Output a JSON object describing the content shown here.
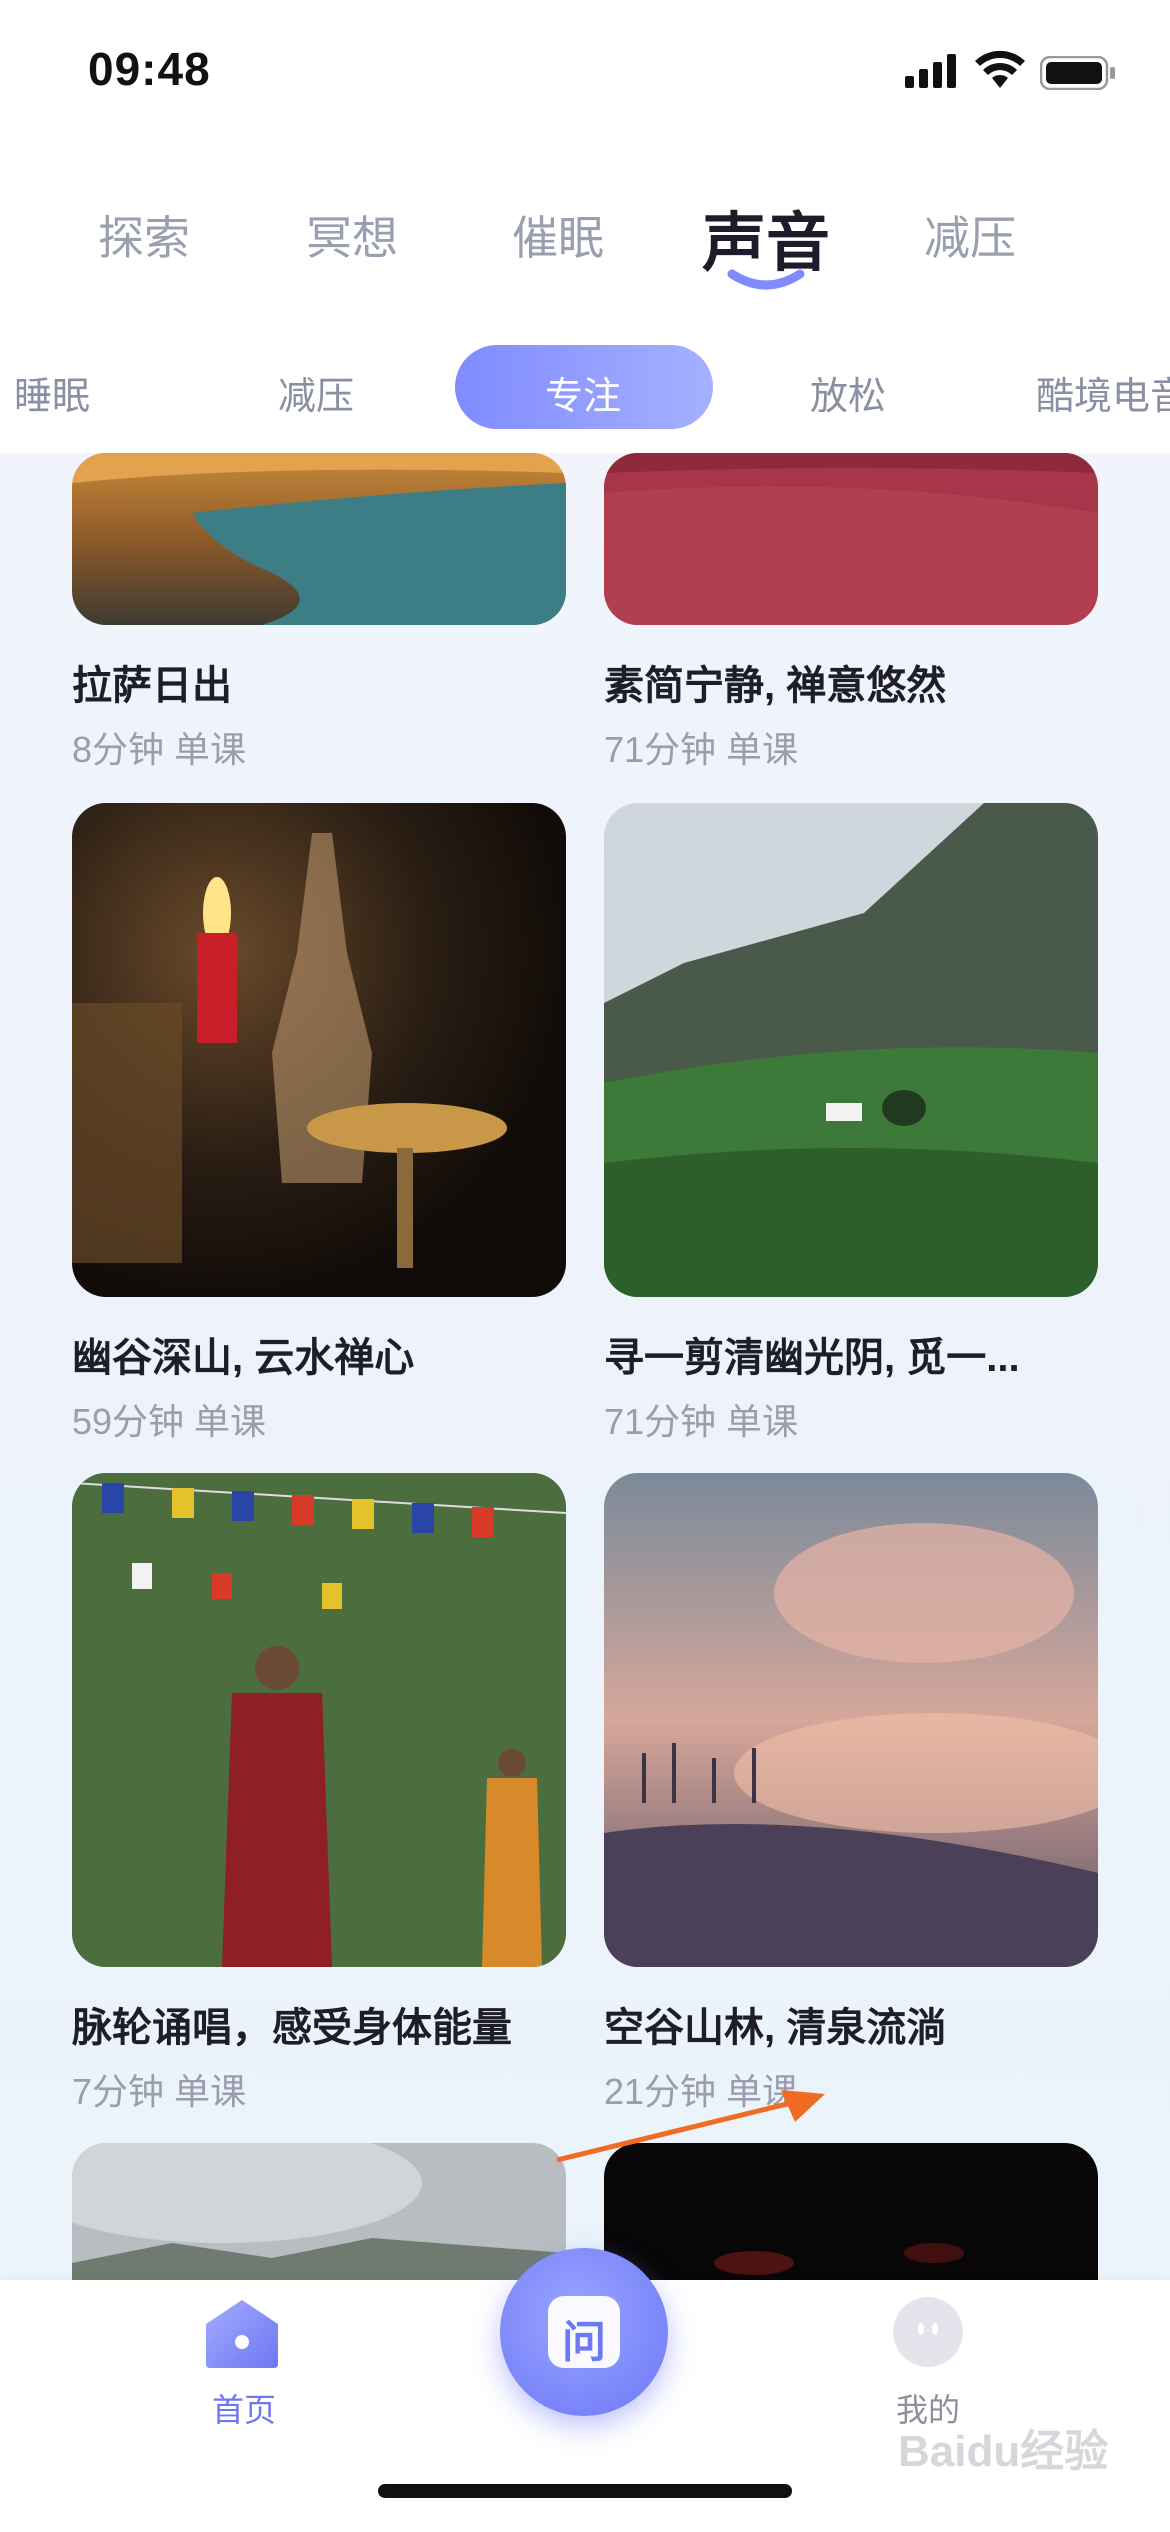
{
  "status_bar": {
    "time": "09:48"
  },
  "top_tabs": [
    {
      "label": "探索"
    },
    {
      "label": "冥想"
    },
    {
      "label": "催眠"
    },
    {
      "label": "声音",
      "active": true
    },
    {
      "label": "减压"
    }
  ],
  "categories": [
    {
      "label": "睡眠"
    },
    {
      "label": "减压"
    },
    {
      "label": "专注",
      "active": true
    },
    {
      "label": "放松"
    },
    {
      "label": "酷境电音"
    }
  ],
  "cards": [
    {
      "title": "拉萨日出",
      "meta": "8分钟 单课",
      "image": "lake-sunrise-photo"
    },
    {
      "title": "素简宁静, 禅意悠然",
      "meta": "71分钟 单课",
      "image": "red-cloth-photo"
    },
    {
      "title": "幽谷深山, 云水禅心",
      "meta": "59分钟 单课",
      "image": "candle-altar-photo"
    },
    {
      "title": "寻一剪清幽光阴, 觅一...",
      "meta": "71分钟 单课",
      "image": "mountain-valley-photo"
    },
    {
      "title": "脉轮诵唱，感受身体能量",
      "meta": "7分钟 单课",
      "image": "monks-prayer-flags-photo"
    },
    {
      "title": "空谷山林, 清泉流淌",
      "meta": "21分钟 单课",
      "image": "misty-forest-photo"
    },
    {
      "title": "",
      "meta": "",
      "image": "cloudy-mountain-photo"
    },
    {
      "title": "",
      "meta": "",
      "image": "dark-lights-photo"
    }
  ],
  "bottom_nav": {
    "home_label": "首页",
    "center_glyph": "问",
    "me_label": "我的"
  },
  "watermark": "Baidu经验",
  "colors": {
    "accent": "#7f8bff",
    "annotation_arrow": "#f26b22"
  }
}
